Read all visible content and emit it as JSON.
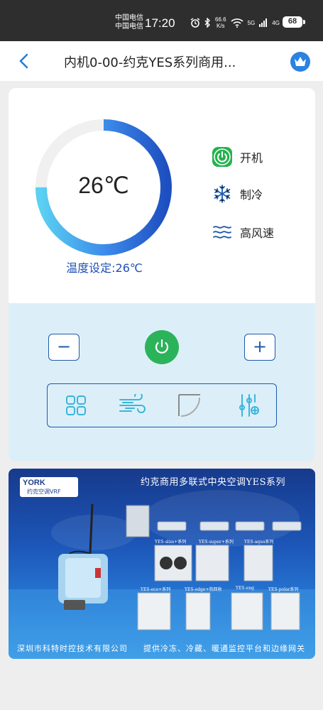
{
  "status_bar": {
    "carrier_1": "中国电信",
    "carrier_2": "中国电信",
    "time": "17:20",
    "speed_value": "66.6",
    "speed_unit": "K/s",
    "signal_tag_1": "5G",
    "signal_tag_2": "4G",
    "battery": "68"
  },
  "nav": {
    "title": "内机0-00-约克YES系列商用..."
  },
  "thermostat": {
    "current_temp": "26℃",
    "setpoint_label": "温度设定:26℃",
    "gauge_fill_fraction": 0.75
  },
  "status": {
    "power": "开机",
    "mode": "制冷",
    "fan": "高风速"
  },
  "controls": {
    "minus": "−",
    "plus": "+"
  },
  "banner": {
    "logo": "YORK",
    "logo_sub": "约克空调VRF",
    "title": "约克商用多联式中央空调YES系列",
    "footer_left": "深圳市科特时控技术有限公司",
    "footer_right": "提供冷冻、冷藏、暖通监控平台和边缘网关",
    "unit_labels": [
      "YES-slim+系列",
      "YES-super+系列",
      "YES-aqua系列",
      "YES-eco+系列",
      "YES-edge+热回收",
      "YES-eng",
      "YES-polar系列"
    ]
  },
  "colors": {
    "accent_blue": "#1e5aa8",
    "power_green": "#2bb35a",
    "controls_bg": "#dceff9"
  }
}
